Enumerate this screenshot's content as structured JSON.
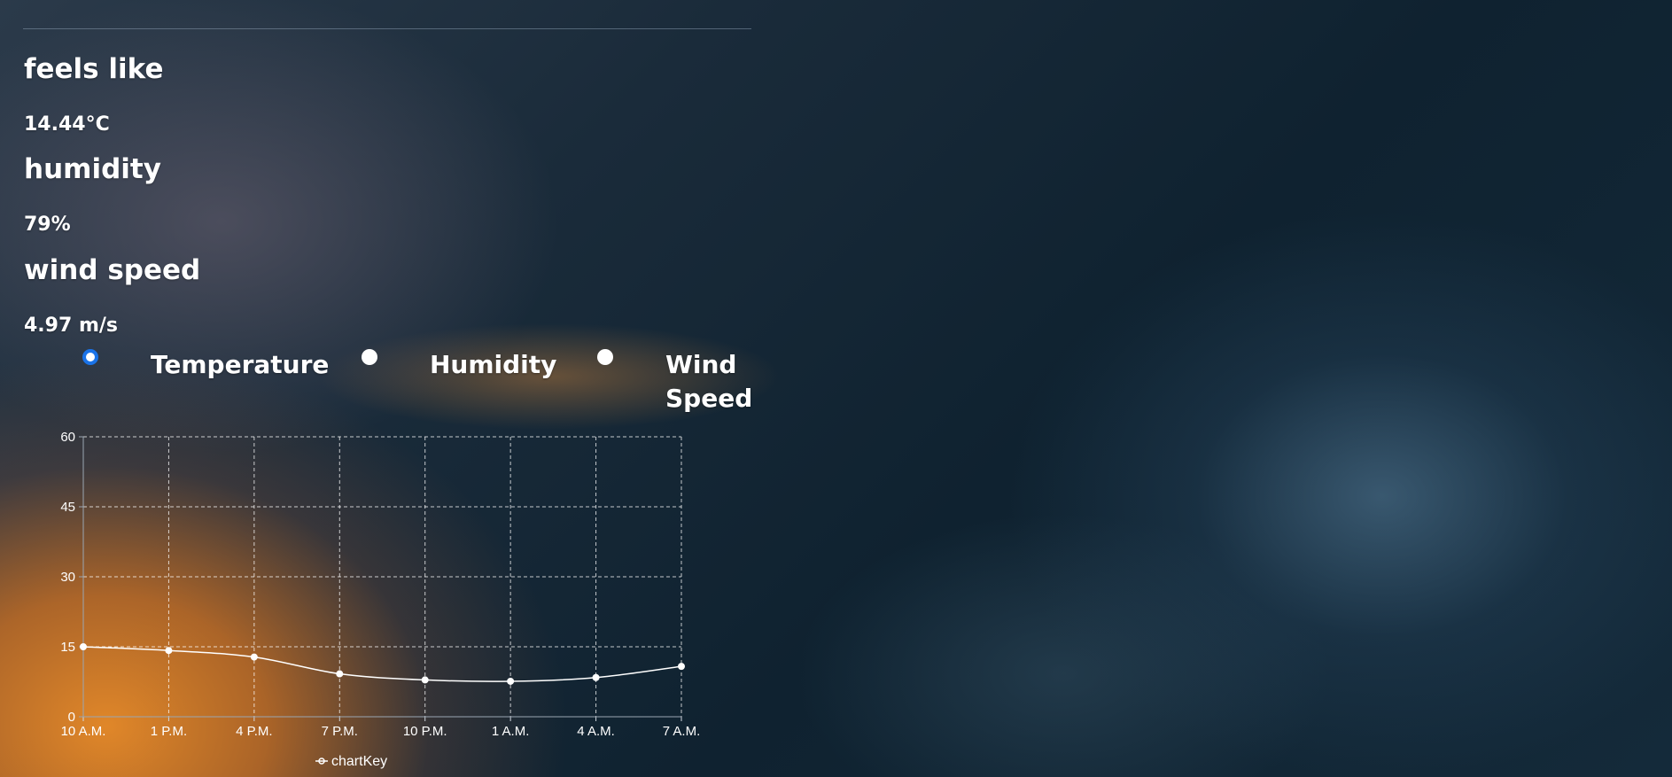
{
  "stats": [
    {
      "label": "feels like",
      "value": "14.44°C"
    },
    {
      "label": "humidity",
      "value": "79%"
    },
    {
      "label": "wind speed",
      "value": "4.97 m/s"
    }
  ],
  "options": [
    {
      "label": "Temperature",
      "checked": true
    },
    {
      "label": "Humidity",
      "checked": false
    },
    {
      "label": "Wind Speed",
      "label_line1": "Wind",
      "label_line2": "Speed",
      "checked": false
    }
  ],
  "colors": {
    "accent": "#1a73e8",
    "line": "#ffffff",
    "grid": "#ffffff"
  },
  "chart_data": {
    "type": "line",
    "categories": [
      "10 A.M.",
      "1 P.M.",
      "4 P.M.",
      "7 P.M.",
      "10 P.M.",
      "1 A.M.",
      "4 A.M.",
      "7 A.M."
    ],
    "series": [
      {
        "name": "chartKey",
        "values": [
          15,
          14.2,
          12.8,
          9.2,
          7.9,
          7.6,
          8.4,
          10.8
        ]
      }
    ],
    "ylim": [
      0,
      60
    ],
    "yticks": [
      "0",
      "15",
      "30",
      "45",
      "60"
    ],
    "grid": true,
    "legend_position": "bottom-center"
  }
}
